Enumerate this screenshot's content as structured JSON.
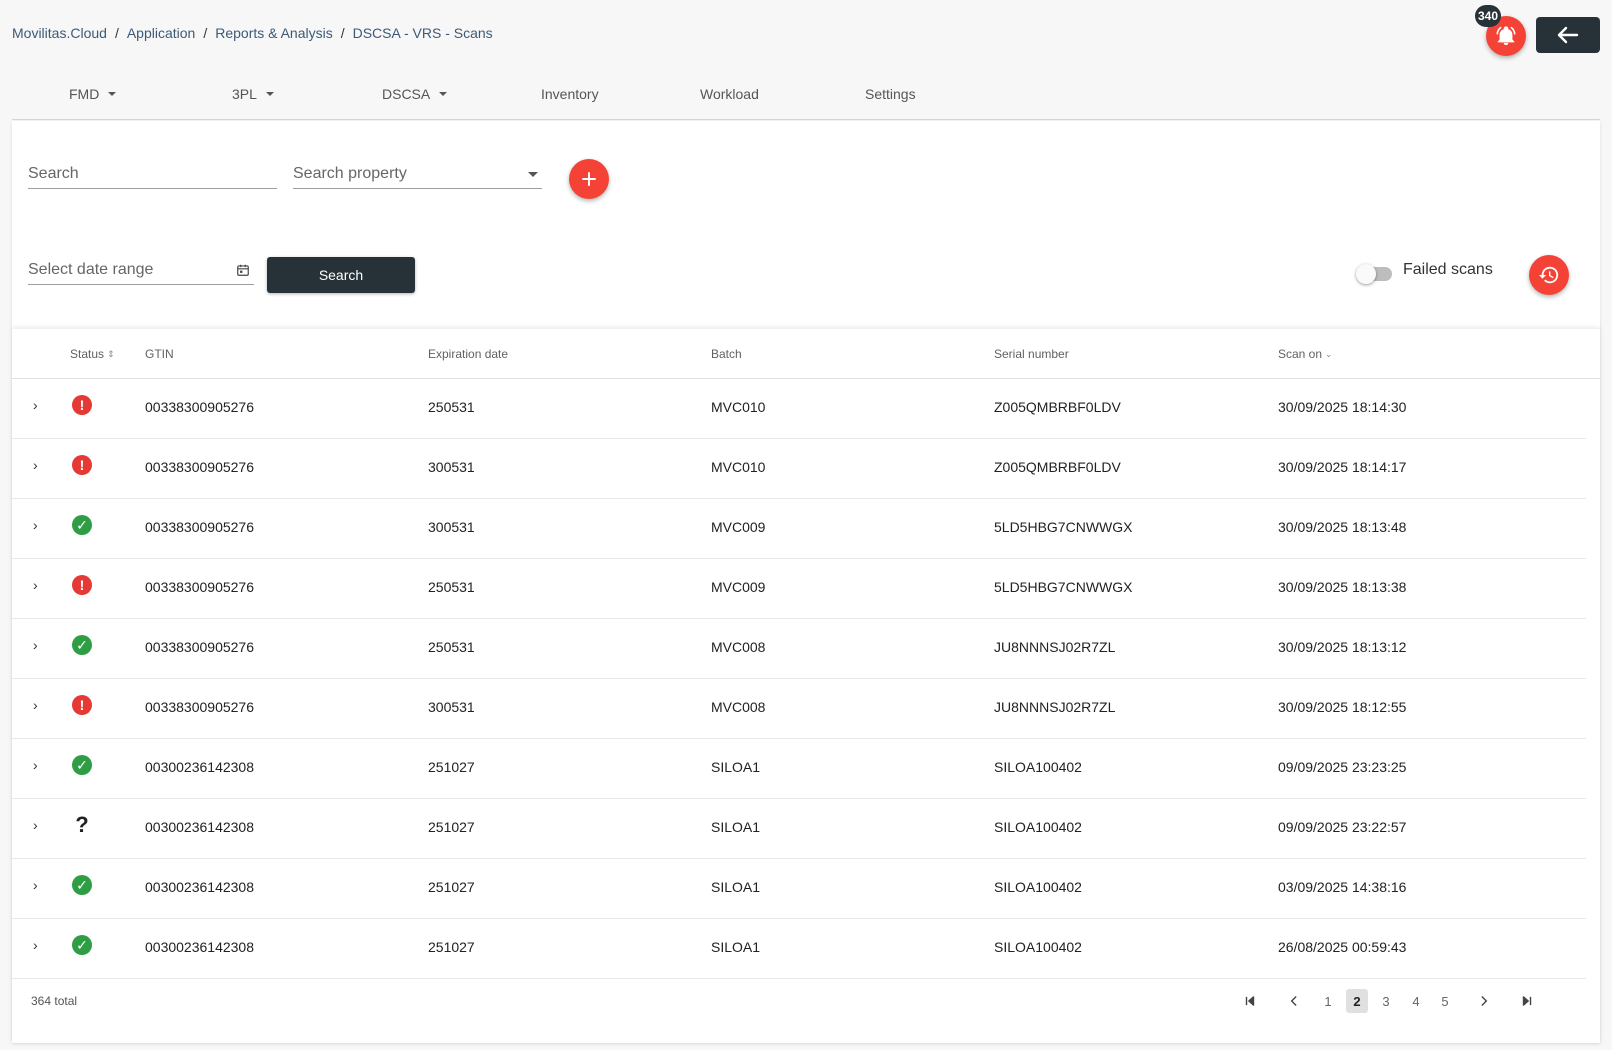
{
  "breadcrumb": [
    "Movilitas.Cloud",
    "Application",
    "Reports & Analysis",
    "DSCSA - VRS - Scans"
  ],
  "notifications": {
    "count": "340"
  },
  "nav": [
    {
      "label": "FMD",
      "dropdown": true
    },
    {
      "label": "3PL",
      "dropdown": true
    },
    {
      "label": "DSCSA",
      "dropdown": true
    },
    {
      "label": "Inventory",
      "dropdown": false
    },
    {
      "label": "Workload",
      "dropdown": false
    },
    {
      "label": "Settings",
      "dropdown": false
    }
  ],
  "filters": {
    "search_placeholder": "Search",
    "property_placeholder": "Search property",
    "date_placeholder": "Select date range",
    "search_button": "Search",
    "failed_scans_label": "Failed scans"
  },
  "table": {
    "headers": [
      "Status",
      "GTIN",
      "Expiration date",
      "Batch",
      "Serial number",
      "Scan on"
    ],
    "rows": [
      {
        "status": "error",
        "gtin": "00338300905276",
        "exp": "250531",
        "batch": "MVC010",
        "serial": "Z005QMBRBF0LDV",
        "scan": "30/09/2025 18:14:30"
      },
      {
        "status": "error",
        "gtin": "00338300905276",
        "exp": "300531",
        "batch": "MVC010",
        "serial": "Z005QMBRBF0LDV",
        "scan": "30/09/2025 18:14:17"
      },
      {
        "status": "success",
        "gtin": "00338300905276",
        "exp": "300531",
        "batch": "MVC009",
        "serial": "5LD5HBG7CNWWGX",
        "scan": "30/09/2025 18:13:48"
      },
      {
        "status": "error",
        "gtin": "00338300905276",
        "exp": "250531",
        "batch": "MVC009",
        "serial": "5LD5HBG7CNWWGX",
        "scan": "30/09/2025 18:13:38"
      },
      {
        "status": "success",
        "gtin": "00338300905276",
        "exp": "250531",
        "batch": "MVC008",
        "serial": "JU8NNNSJ02R7ZL",
        "scan": "30/09/2025 18:13:12"
      },
      {
        "status": "error",
        "gtin": "00338300905276",
        "exp": "300531",
        "batch": "MVC008",
        "serial": "JU8NNNSJ02R7ZL",
        "scan": "30/09/2025 18:12:55"
      },
      {
        "status": "success",
        "gtin": "00300236142308",
        "exp": "251027",
        "batch": "SILOA1",
        "serial": "SILOA100402",
        "scan": "09/09/2025 23:23:25"
      },
      {
        "status": "unknown",
        "gtin": "00300236142308",
        "exp": "251027",
        "batch": "SILOA1",
        "serial": "SILOA100402",
        "scan": "09/09/2025 23:22:57"
      },
      {
        "status": "success",
        "gtin": "00300236142308",
        "exp": "251027",
        "batch": "SILOA1",
        "serial": "SILOA100402",
        "scan": "03/09/2025 14:38:16"
      },
      {
        "status": "success",
        "gtin": "00300236142308",
        "exp": "251027",
        "batch": "SILOA1",
        "serial": "SILOA100402",
        "scan": "26/08/2025 00:59:43"
      }
    ]
  },
  "pagination": {
    "total_label": "364 total",
    "pages": [
      "1",
      "2",
      "3",
      "4",
      "5"
    ],
    "current": "2"
  },
  "colors": {
    "accent": "#f44336",
    "dark": "#263238",
    "error": "#e53935",
    "success": "#2e9d43"
  }
}
